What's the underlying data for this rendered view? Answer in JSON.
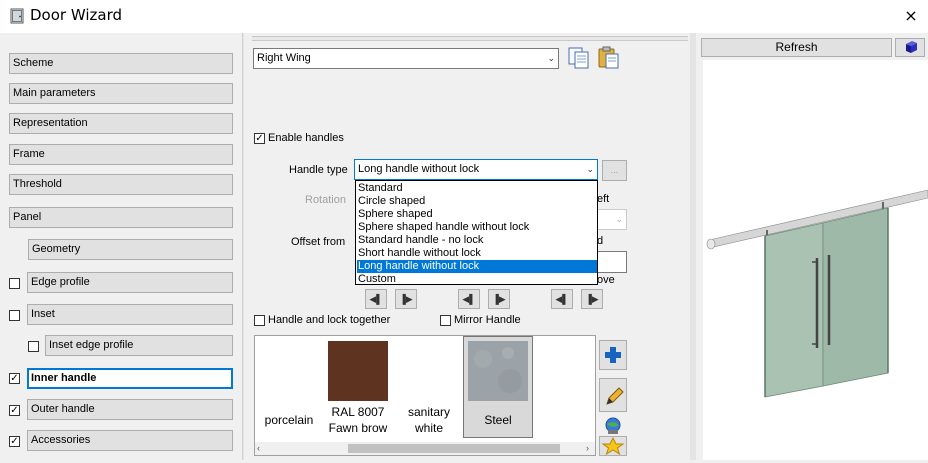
{
  "window": {
    "title": "Door Wizard",
    "close_icon": "×"
  },
  "nav": {
    "items": [
      {
        "label": "Scheme"
      },
      {
        "label": "Main parameters"
      },
      {
        "label": "Representation"
      },
      {
        "label": "Frame"
      },
      {
        "label": "Threshold"
      },
      {
        "label": "Panel"
      },
      {
        "label": "Geometry"
      },
      {
        "label": "Edge profile",
        "checked": false
      },
      {
        "label": "Inset",
        "checked": false
      },
      {
        "label": "Inset edge profile",
        "checked": false
      },
      {
        "label": "Inner handle",
        "checked": true,
        "active": true
      },
      {
        "label": "Outer handle",
        "checked": true
      },
      {
        "label": "Accessories",
        "checked": true
      }
    ]
  },
  "main": {
    "wing_select": "Right Wing",
    "enable_handles": {
      "label": "Enable handles",
      "checked": true
    },
    "handle_type": {
      "label": "Handle type",
      "value": "Long handle without lock",
      "browse": "..."
    },
    "rotation_label": "Rotation",
    "offset_label": "Offset from",
    "partial_right": {
      "eft": "eft",
      "d": "d",
      "ove": "ove"
    },
    "dropdown_options": [
      "Standard",
      "Circle shaped",
      "Sphere shaped",
      "Sphere shaped handle without lock",
      "Standard handle - no lock",
      "Short handle without lock",
      "Long handle without lock",
      "Custom"
    ],
    "selected_option_index": 6,
    "handle_and_lock": {
      "label": "Handle and lock together",
      "checked": false
    },
    "mirror_handle": {
      "label": "Mirror Handle",
      "checked": false
    },
    "materials": [
      {
        "label": "porcelain",
        "color": "#ffffff"
      },
      {
        "label": "RAL 8007 Fawn  brow",
        "color": "#5e3420"
      },
      {
        "label": "sanitary white",
        "color": "#ffffff"
      },
      {
        "label": "Steel",
        "color": "#9aa0a6",
        "selected": true
      }
    ]
  },
  "preview": {
    "refresh_label": "Refresh"
  },
  "colors": {
    "accent": "#0078d7",
    "glass": "#a9c2b2"
  }
}
